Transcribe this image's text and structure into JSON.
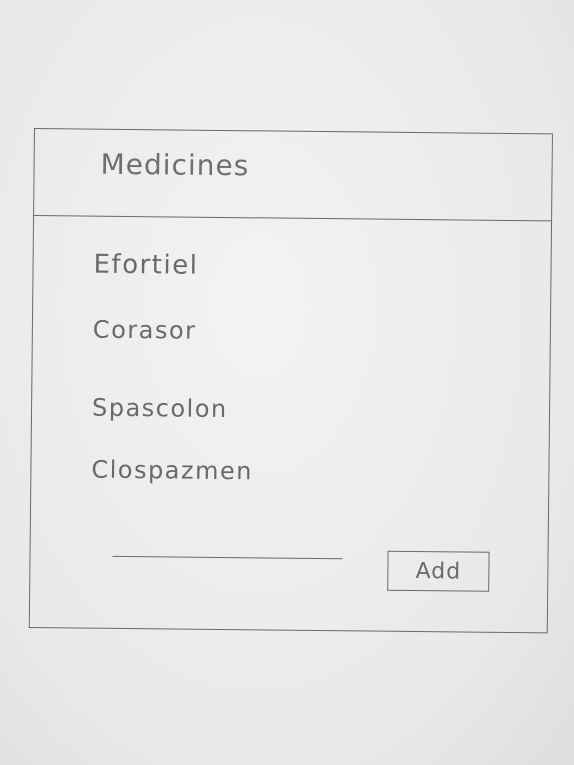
{
  "window": {
    "title": "Medicines"
  },
  "medicines": [
    {
      "label": "Efortiel"
    },
    {
      "label": "Corasor"
    },
    {
      "label": "Spascolon"
    },
    {
      "label": "Clospazmen"
    }
  ],
  "add_form": {
    "input_value": "",
    "button_label": "Add"
  }
}
